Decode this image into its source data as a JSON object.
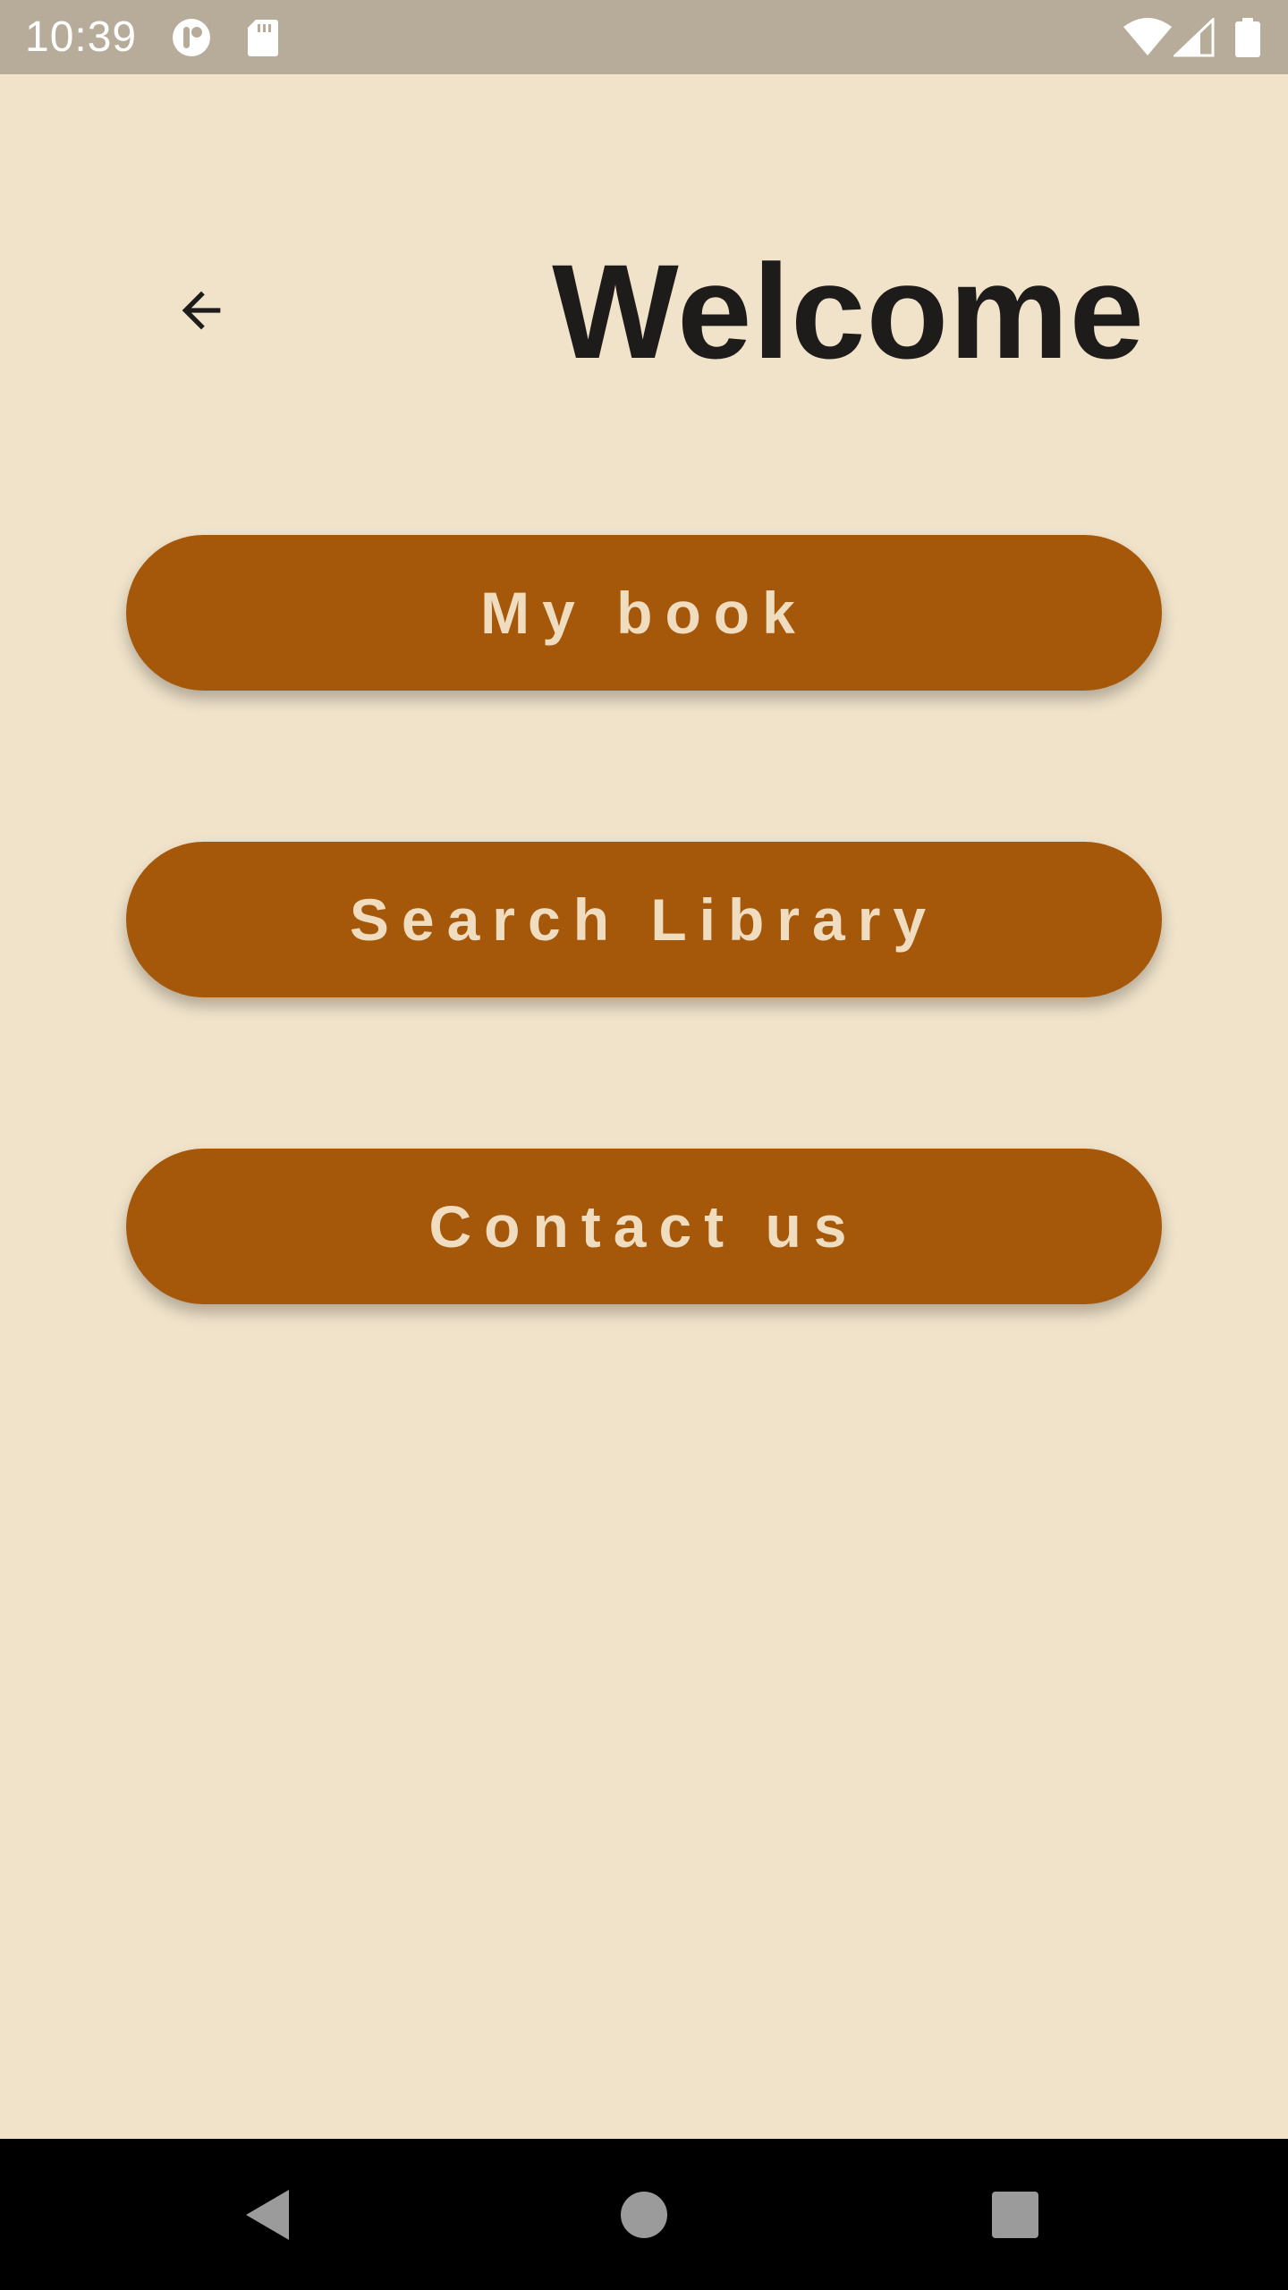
{
  "status_bar": {
    "time": "10:39",
    "left_icons": [
      "assistant-icon",
      "sd-card-icon"
    ],
    "right_icons": [
      "wifi-icon",
      "cell-signal-icon",
      "battery-icon"
    ]
  },
  "header": {
    "back_icon": "arrow-left-icon",
    "title": "Welcome"
  },
  "menu": {
    "buttons": [
      {
        "label": "My book"
      },
      {
        "label": "Search Library"
      },
      {
        "label": "Contact us"
      }
    ]
  },
  "nav_bar": {
    "buttons": [
      "back-triangle-icon",
      "home-circle-icon",
      "recents-square-icon"
    ]
  },
  "colors": {
    "background": "#f0e3ca",
    "status_bar": "#b7ab9a",
    "button": "#a5570a",
    "button_text": "#f0dcbf",
    "title_text": "#1e1c1a"
  }
}
